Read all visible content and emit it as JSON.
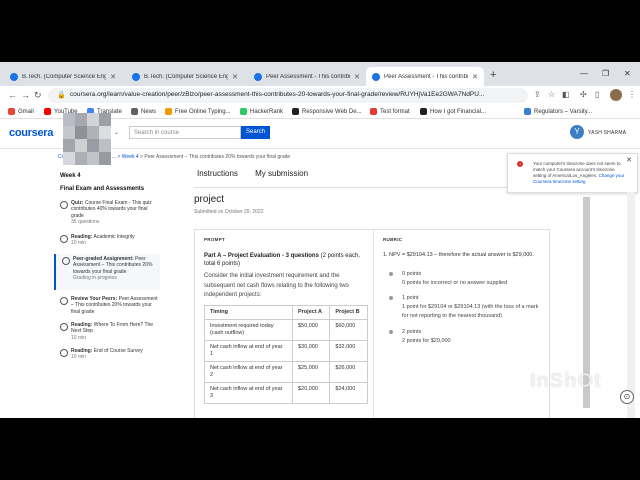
{
  "browser": {
    "tabs": [
      {
        "title": "B.Tech. (Computer Science Engir",
        "active": false
      },
      {
        "title": "B.Tech. (Computer Science Engir",
        "active": false
      },
      {
        "title": "Peer Assessment - This contribut",
        "active": false
      },
      {
        "title": "Peer Assessment - This contribute",
        "active": true
      }
    ],
    "new_tab": "+",
    "url": "coursera.org/learn/value-creation/peer/zBlzo/peer-assessment-this-contributes-20-towards-your-final-grade/review/RUYHjVa1Ee2GWA7NdPU...",
    "bookmarks": [
      {
        "label": "Gmail",
        "color": "#ea4335"
      },
      {
        "label": "YouTube",
        "color": "#ff0000"
      },
      {
        "label": "Translate",
        "color": "#4285f4"
      },
      {
        "label": "News",
        "color": "#5f6368"
      },
      {
        "label": "Free Online Typing...",
        "color": "#f29900"
      },
      {
        "label": "HackerRank",
        "color": "#2ec866"
      },
      {
        "label": "Responsive Web De...",
        "color": "#202124"
      },
      {
        "label": "Test format",
        "color": "#e53935"
      },
      {
        "label": "How I got Financial...",
        "color": "#202124"
      },
      {
        "label": "Regulators – Varsity...",
        "color": "#387ed1"
      }
    ]
  },
  "header": {
    "logo": "coursera",
    "search_placeholder": "Search in course",
    "search_button": "Search",
    "avatar_initial": "Y",
    "username": "YASH SHARMA"
  },
  "breadcrumb": {
    "item1": "Co",
    "item2": "...sion ...",
    "sep": ">",
    "item3": "Week 4",
    "item4": "Peer Assessment – This contributes 20% towards your final grade"
  },
  "sidebar": {
    "week": "Week 4",
    "section": "Final Exam and Assessments",
    "items": [
      {
        "kind": "Quiz:",
        "title": "Course Final Exam - This quiz contributes 40% towards your final grade",
        "meta": "35 questions"
      },
      {
        "kind": "Reading:",
        "title": "Academic Integrity",
        "meta": "10 min"
      },
      {
        "kind": "Peer-graded Assignment:",
        "title": "Peer Assessment – This contributes 20% towards your final grade",
        "meta": "Grading in progress"
      },
      {
        "kind": "Review Your Peers:",
        "title": "Peer Assessment – This contributes 20% towards your final grade",
        "meta": ""
      },
      {
        "kind": "Reading:",
        "title": "Where To From Here? The Next Step",
        "meta": "10 min"
      },
      {
        "kind": "Reading:",
        "title": "End of Course Survey",
        "meta": "10 min"
      }
    ]
  },
  "main": {
    "tab_instructions": "Instructions",
    "tab_submission": "My submission",
    "title": "project",
    "submitted": "Submitted on October 29, 2022",
    "prompt_label": "PROMPT",
    "prompt_heading_bold": "Part A – Project Evaluation - 3 questions",
    "prompt_heading_rest": " (2 points each, total 6 points)",
    "prompt_body": "Consider the initial investment requirement and the subsequent net cash flows relating to the following two independent projects:",
    "table": {
      "headers": [
        "Timing",
        "Project A",
        "Project B"
      ],
      "rows": [
        [
          "Investment required today (cash outflow)",
          "$50,000",
          "$60,000"
        ],
        [
          "Net cash inflow at end of year 1",
          "$30,000",
          "$32,000"
        ],
        [
          "Net cash inflow at end of year 2",
          "$25,000",
          "$26,000"
        ],
        [
          "Net cash inflow at end of year 3",
          "$20,000",
          "$24,000"
        ]
      ]
    },
    "rubric_label": "RUBRIC",
    "rubric_question": "1. NPV = $29104.13 – therefore the actual answer is $29,000.",
    "options": [
      {
        "points": "0 points",
        "desc": "0 points for incorrect or no answer supplied"
      },
      {
        "points": "1 point",
        "desc": "1 point for $29104 or $29104.13 (with the loss of a mark for not reporting to the nearest thousand)"
      },
      {
        "points": "2 points",
        "desc": "2 points for $29,000"
      }
    ]
  },
  "toast": {
    "message": "Your computer's timezone does not seem to match your Coursera account's timezone setting of America/Los_Angeles.",
    "link": "Change your Coursera timezone setting"
  },
  "watermark": "InShOt"
}
